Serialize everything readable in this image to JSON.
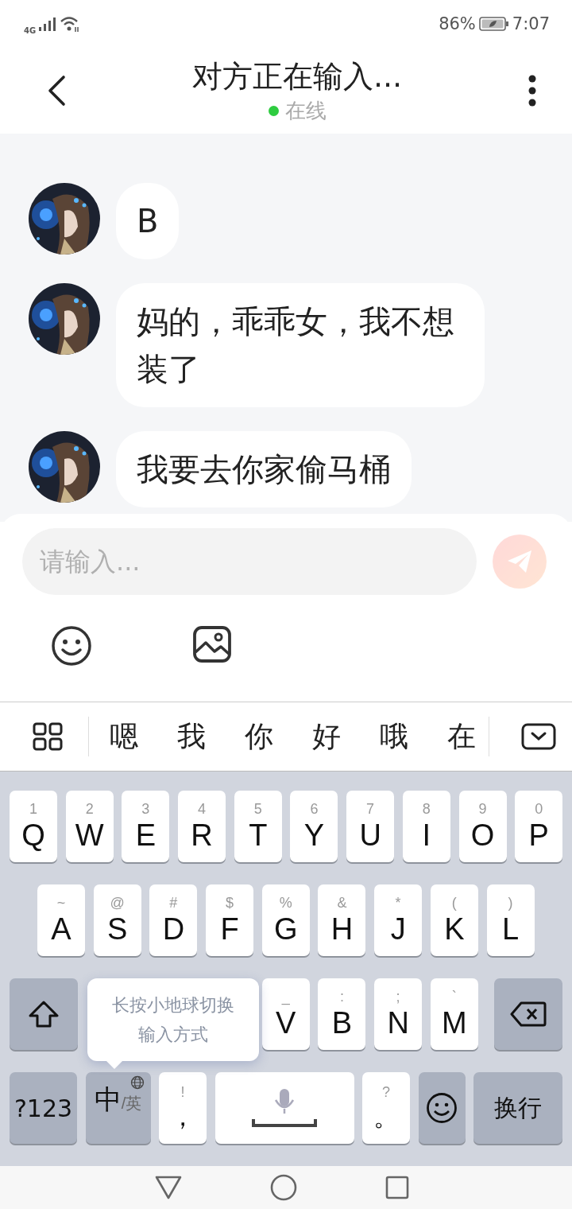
{
  "status_bar": {
    "network": "4G",
    "battery": "86%",
    "time": "7:07"
  },
  "header": {
    "title": "对方正在输入...",
    "status": "在线",
    "online": true
  },
  "messages": [
    {
      "text": "B"
    },
    {
      "text": "妈的，乖乖女，我不想装了"
    },
    {
      "text": "我要去你家偷马桶"
    }
  ],
  "composer": {
    "placeholder": "请输入...",
    "send_disabled": true
  },
  "candidates": [
    "嗯",
    "我",
    "你",
    "好",
    "哦",
    "在"
  ],
  "keyboard": {
    "number_row": [
      {
        "kind": "letter",
        "sub": "1",
        "main": "Q"
      },
      {
        "kind": "letter",
        "sub": "2",
        "main": "W"
      },
      {
        "kind": "letter",
        "sub": "3",
        "main": "E"
      },
      {
        "kind": "letter",
        "sub": "4",
        "main": "R"
      },
      {
        "kind": "letter",
        "sub": "5",
        "main": "T"
      },
      {
        "kind": "letter",
        "sub": "6",
        "main": "Y"
      },
      {
        "kind": "letter",
        "sub": "7",
        "main": "U"
      },
      {
        "kind": "letter",
        "sub": "8",
        "main": "I"
      },
      {
        "kind": "letter",
        "sub": "9",
        "main": "O"
      },
      {
        "kind": "letter",
        "sub": "0",
        "main": "P"
      }
    ],
    "home_row": [
      {
        "kind": "letter",
        "sub": "~",
        "main": "A"
      },
      {
        "kind": "letter",
        "sub": "@",
        "main": "S"
      },
      {
        "kind": "letter",
        "sub": "#",
        "main": "D"
      },
      {
        "kind": "letter",
        "sub": "$",
        "main": "F"
      },
      {
        "kind": "letter",
        "sub": "%",
        "main": "G"
      },
      {
        "kind": "letter",
        "sub": "&",
        "main": "H"
      },
      {
        "kind": "letter",
        "sub": "*",
        "main": "J"
      },
      {
        "kind": "letter",
        "sub": "(",
        "main": "K"
      },
      {
        "kind": "letter",
        "sub": ")",
        "main": "L"
      }
    ],
    "lower_row": [
      {
        "kind": "shift"
      },
      {
        "kind": "covered"
      },
      {
        "kind": "covered"
      },
      {
        "kind": "covered"
      },
      {
        "kind": "letter",
        "sub": "_",
        "main": "V"
      },
      {
        "kind": "letter",
        "sub": ":",
        "main": "B"
      },
      {
        "kind": "letter",
        "sub": ";",
        "main": "N"
      },
      {
        "kind": "letter",
        "sub": "`",
        "main": "M"
      },
      {
        "kind": "delete"
      }
    ],
    "function_row": [
      {
        "kind": "func",
        "main": "?123"
      },
      {
        "kind": "lang",
        "main": "中",
        "sub": "/英"
      },
      {
        "kind": "punct",
        "sub": "!",
        "main": "，"
      },
      {
        "kind": "space"
      },
      {
        "kind": "punct",
        "sub": "?",
        "main": "。"
      },
      {
        "kind": "emoji"
      },
      {
        "kind": "func",
        "main": "换行"
      }
    ],
    "tooltip": [
      "长按小地球切换",
      "输入方式"
    ]
  }
}
